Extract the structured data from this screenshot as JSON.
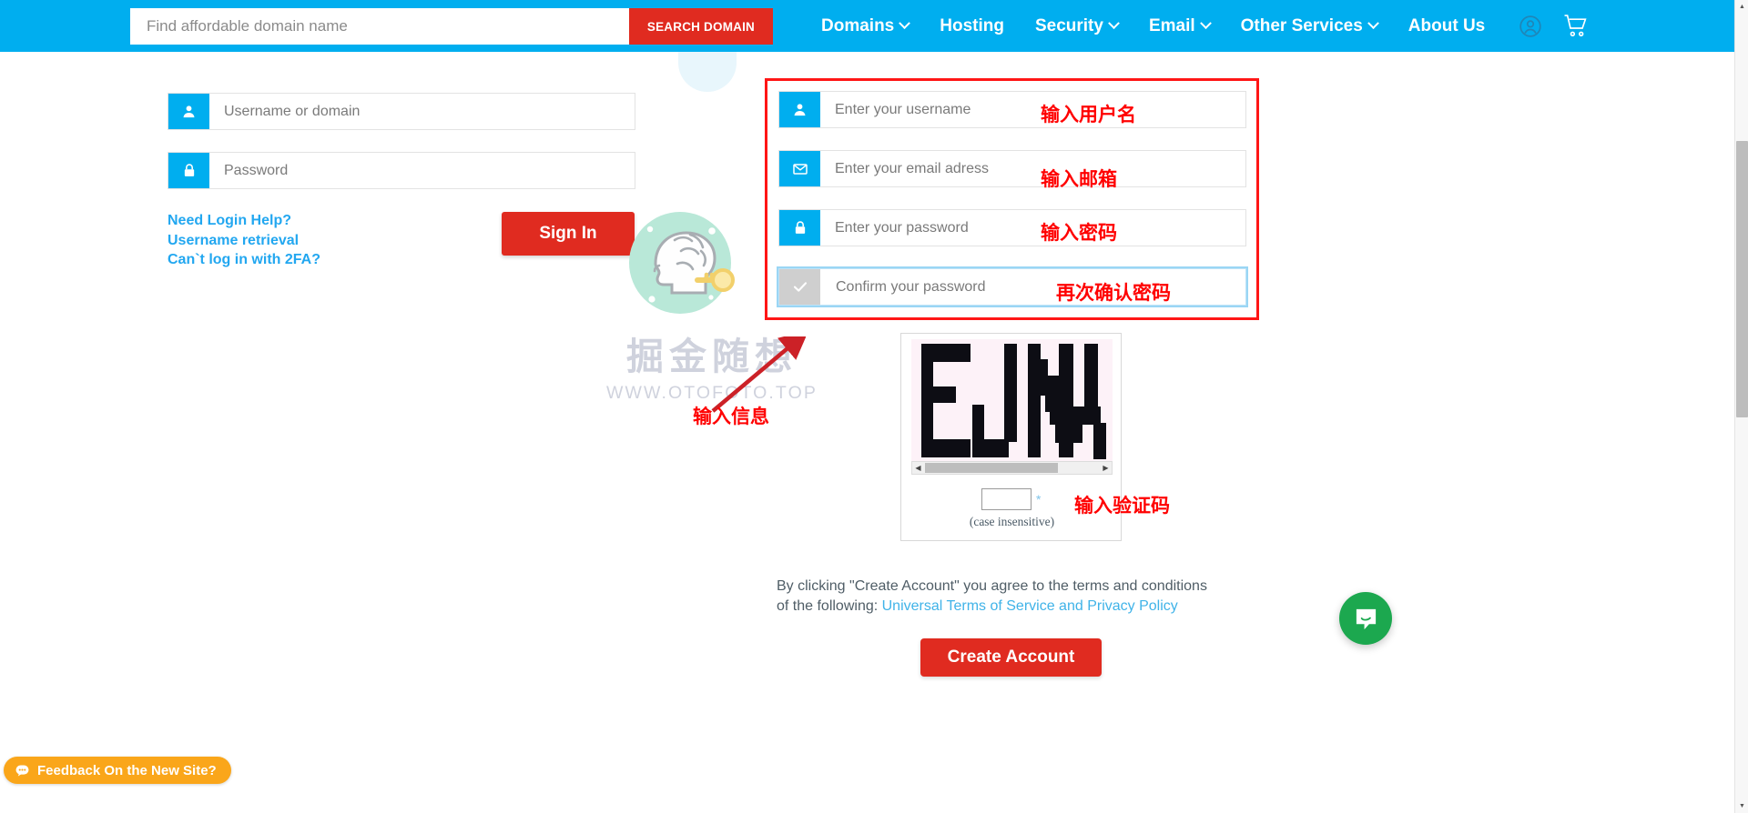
{
  "header": {
    "search": {
      "placeholder": "Find affordable domain name",
      "value": "",
      "button_label": "SEARCH DOMAIN"
    },
    "nav_items": [
      {
        "label": "Domains",
        "has_caret": true
      },
      {
        "label": "Hosting",
        "has_caret": false
      },
      {
        "label": "Security",
        "has_caret": true
      },
      {
        "label": "Email",
        "has_caret": true
      },
      {
        "label": "Other Services",
        "has_caret": true
      },
      {
        "label": "About Us",
        "has_caret": false
      }
    ],
    "icons": [
      {
        "name": "account-icon"
      },
      {
        "name": "cart-icon"
      }
    ],
    "background_color": "#00AEEF",
    "search_button_color": "#E02B20"
  },
  "login": {
    "username": {
      "placeholder": "Username or domain",
      "value": "",
      "icon": "user-icon"
    },
    "password": {
      "placeholder": "Password",
      "value": "",
      "icon": "lock-icon"
    },
    "links": [
      "Need Login Help?",
      "Username retrieval",
      "Can`t log in with 2FA?"
    ],
    "signin_label": "Sign In",
    "link_color": "#22A7F0",
    "signin_color": "#E02B20"
  },
  "register": {
    "fields": [
      {
        "placeholder": "Enter your username",
        "value": "",
        "icon": "user-icon",
        "focused": false,
        "annotation": "输入用户名"
      },
      {
        "placeholder": "Enter your email adress",
        "value": "",
        "icon": "envelope-icon",
        "focused": false,
        "annotation": "输入邮箱"
      },
      {
        "placeholder": "Enter your password",
        "value": "",
        "icon": "lock-icon",
        "focused": false,
        "annotation": "输入密码"
      },
      {
        "placeholder": "Confirm your password",
        "value": "",
        "icon": "check-icon",
        "focused": true,
        "annotation": "再次确认密码"
      }
    ]
  },
  "captcha": {
    "input_value": "",
    "required_marker": "*",
    "note": "(case insensitive)",
    "annotation": "输入验证码",
    "image_text": "EJNI",
    "scroll_left_arrow": "◀",
    "scroll_right_arrow": "▶"
  },
  "terms": {
    "prefix": "By clicking \"Create Account\" you agree to the terms and conditions of the following: ",
    "link_text": "Universal Terms of Service and Privacy Policy",
    "link_color": "#40B3E8"
  },
  "create_account": {
    "label": "Create Account",
    "color": "#E02B20"
  },
  "annotations": {
    "center_note": "输入信息",
    "box_color": "#FF1616",
    "text_color": "#FF0000"
  },
  "watermark": {
    "chinese": "掘金随想",
    "url": "WWW.OTOFOTO.TOP",
    "color": "#cfd2dd"
  },
  "feedback": {
    "label": "Feedback On the New Site?",
    "icon": "chat-bubble-icon",
    "color": "#FAA61A"
  },
  "chat": {
    "icon": "intercom-chat-icon",
    "color": "#1CA84F"
  }
}
